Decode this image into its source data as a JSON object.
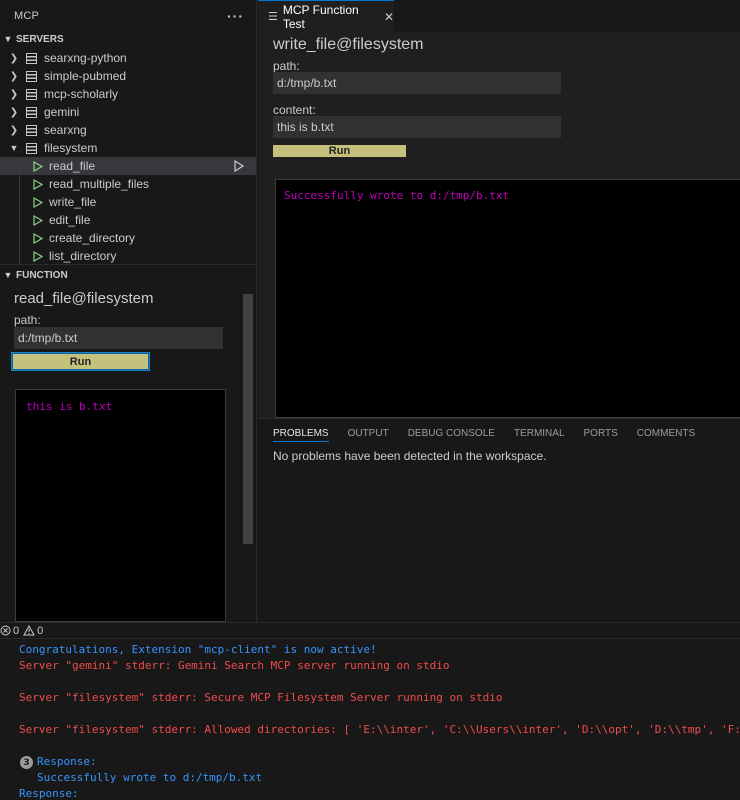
{
  "sidebar": {
    "title": "MCP",
    "more_label": "···",
    "servers_section": "SERVERS",
    "servers": [
      {
        "name": "searxng-python",
        "expanded": false
      },
      {
        "name": "simple-pubmed",
        "expanded": false
      },
      {
        "name": "mcp-scholarly",
        "expanded": false
      },
      {
        "name": "gemini",
        "expanded": false
      },
      {
        "name": "searxng",
        "expanded": false
      },
      {
        "name": "filesystem",
        "expanded": true
      }
    ],
    "tools": [
      "read_file",
      "read_multiple_files",
      "write_file",
      "edit_file",
      "create_directory",
      "list_directory"
    ],
    "selected_tool": "read_file",
    "function_section": "FUNCTION",
    "function": {
      "title": "read_file@filesystem",
      "path_label": "path:",
      "path_value": "d:/tmp/b.txt",
      "run_label": "Run",
      "output": "this is b.txt"
    }
  },
  "editor": {
    "tab_label": "MCP Function Test",
    "title": "write_file@filesystem",
    "path_label": "path:",
    "path_value": "d:/tmp/b.txt",
    "content_label": "content:",
    "content_value": "this is b.txt",
    "run_label": "Run",
    "output": "Successfully wrote to d:/tmp/b.txt"
  },
  "panel": {
    "tabs": [
      "PROBLEMS",
      "OUTPUT",
      "DEBUG CONSOLE",
      "TERMINAL",
      "PORTS",
      "COMMENTS"
    ],
    "active_tab": "PROBLEMS",
    "message": "No problems have been detected in the workspace."
  },
  "status": {
    "errors": "0",
    "warnings": "0"
  },
  "console": {
    "lines": [
      {
        "text": "Congratulations, Extension \"mcp-client\" is now active!",
        "color": "#3794ff"
      },
      {
        "text": "Server \"gemini\" stderr: Gemini Search MCP server running on stdio",
        "color": "#f14c4c"
      },
      {
        "text": "Server \"filesystem\" stderr: Secure MCP Filesystem Server running on stdio",
        "color": "#f14c4c"
      },
      {
        "text": "Server \"filesystem\" stderr: Allowed directories: [ 'E:\\\\inter', 'C:\\\\Users\\\\inter', 'D:\\\\opt', 'D:\\\\tmp', 'F:\\\\' ]",
        "color": "#f14c4c"
      }
    ],
    "badge_count": "3",
    "response_label": "Response:",
    "response_value": "Successfully wrote to d:/tmp/b.txt",
    "response_label_2": "Response:"
  }
}
